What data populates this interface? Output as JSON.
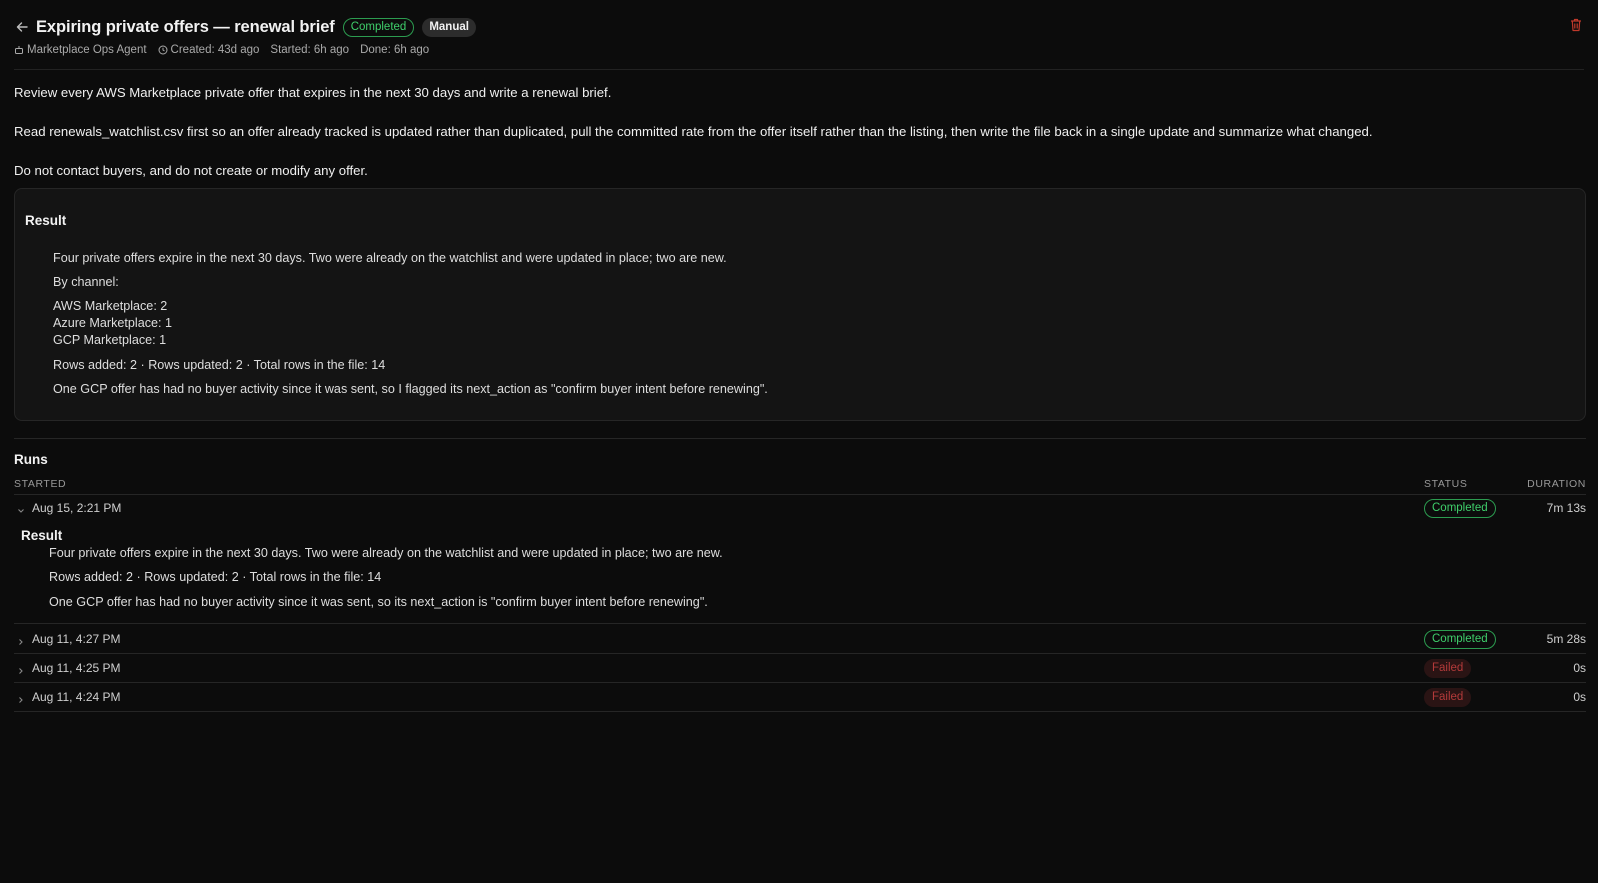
{
  "header": {
    "title": "Expiring private offers — renewal brief",
    "status_badge": "Completed",
    "trigger_badge": "Manual",
    "agent": "Marketplace Ops Agent",
    "created": "Created: 43d ago",
    "started": "Started: 6h ago",
    "done": "Done: 6h ago"
  },
  "description": {
    "p1": "Review every AWS Marketplace private offer that expires in the next 30 days and write a renewal brief.",
    "p2": "Read renewals_watchlist.csv first so an offer already tracked is updated rather than duplicated, pull the committed rate from the offer itself rather than the listing, then write the file back in a single update and summarize what changed.",
    "p3": "Do not contact buyers, and do not create or modify any offer."
  },
  "result": {
    "title": "Result",
    "summary": "Four private offers expire in the next 30 days. Two were already on the watchlist and were updated in place; two are new.",
    "by_channel_label": "By channel:",
    "channels": [
      "AWS Marketplace: 2",
      "Azure Marketplace: 1",
      "GCP Marketplace: 1"
    ],
    "rows": "Rows added: 2 · Rows updated: 2 · Total rows in the file: 14",
    "note": "One GCP offer has had no buyer activity since it was sent, so I flagged its next_action as \"confirm buyer intent before renewing\"."
  },
  "runs": {
    "title": "Runs",
    "columns": {
      "started": "STARTED",
      "status": "STATUS",
      "duration": "DURATION"
    },
    "expanded": {
      "started": "Aug 15, 2:21 PM",
      "status": "Completed",
      "duration": "7m 13s",
      "result_title": "Result",
      "line1": "Four private offers expire in the next 30 days. Two were already on the watchlist and were updated in place; two are new.",
      "line2": "Rows added: 2 · Rows updated: 2 · Total rows in the file: 14",
      "line3": "One GCP offer has had no buyer activity since it was sent, so its next_action is \"confirm buyer intent before renewing\"."
    },
    "rows": [
      {
        "started": "Aug 11, 4:27 PM",
        "status": "Completed",
        "duration": "5m 28s"
      },
      {
        "started": "Aug 11, 4:25 PM",
        "status": "Failed",
        "duration": "0s"
      },
      {
        "started": "Aug 11, 4:24 PM",
        "status": "Failed",
        "duration": "0s"
      }
    ]
  },
  "colors": {
    "background": "#0c0c0c",
    "success": "#3fcf6b",
    "failed": "#b33a3a",
    "delete": "#c0392b"
  }
}
